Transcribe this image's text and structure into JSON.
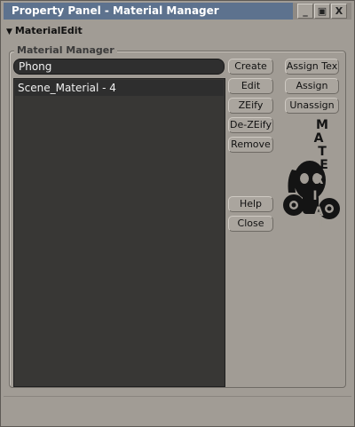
{
  "window": {
    "title": "Property Panel - Material Manager",
    "controls": {
      "minimize": "_",
      "maximize": "▣",
      "close": "X"
    }
  },
  "section": {
    "title": "MaterialEdit"
  },
  "group": {
    "title": "Material Manager"
  },
  "name_field": {
    "value": "Phong"
  },
  "materials": [
    {
      "label": "Scene_Material - 4"
    }
  ],
  "buttons": {
    "create": "Create",
    "edit": "Edit",
    "zeify": "ZEify",
    "dezeify": "De-ZEify",
    "remove": "Remove",
    "help": "Help",
    "close": "Close",
    "assign_tex": "Assign Tex",
    "assign": "Assign",
    "unassign": "Unassign"
  },
  "logo": {
    "text": "MATERIAL"
  },
  "colors": {
    "title_bar": "#5d728e",
    "panel_bg": "#a19c95",
    "list_bg": "#383735",
    "field_bg": "#2f2f2f"
  }
}
